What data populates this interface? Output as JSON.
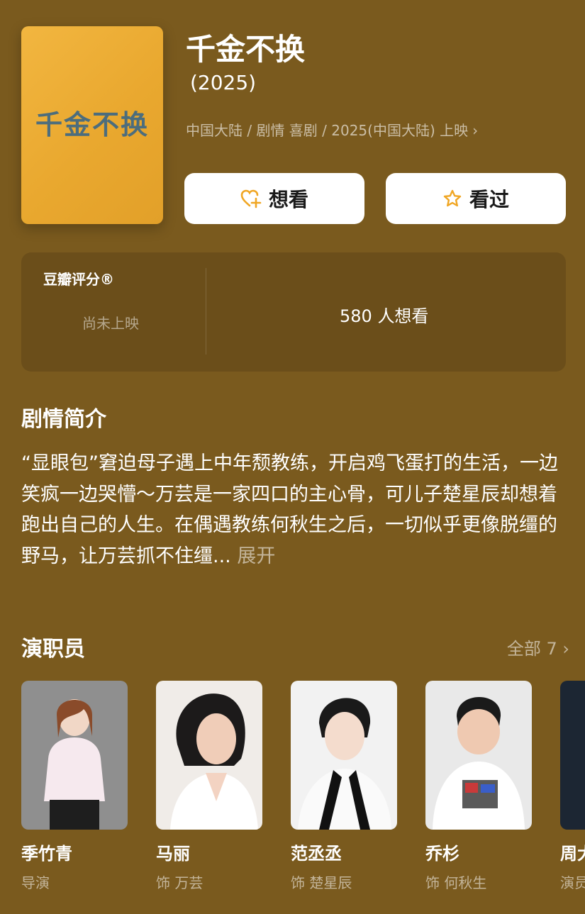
{
  "movie": {
    "poster_text": "千金不换",
    "title": "千金不换",
    "year": "(2025)",
    "meta": "中国大陆 / 剧情 喜剧 / 2025(中国大陆) 上映",
    "meta_chevron": "›"
  },
  "actions": {
    "want_label": "想看",
    "seen_label": "看过"
  },
  "rating": {
    "label": "豆瓣评分®",
    "status": "尚未上映",
    "wish_count": "580 人想看"
  },
  "synopsis": {
    "heading": "剧情简介",
    "text": "“显眼包”窘迫母子遇上中年颓教练，开启鸡飞蛋打的生活，一边笑疯一边哭懵～万芸是一家四口的主心骨，可儿子楚星辰却想着跑出自己的人生。在偶遇教练何秋生之后，一切似乎更像脱缰的野马，让万芸抓不住缰...",
    "expand": "展开"
  },
  "cast": {
    "heading": "演职员",
    "all_label": "全部 7",
    "all_chevron": "›",
    "members": [
      {
        "name": "季竹青",
        "role": "导演"
      },
      {
        "name": "马丽",
        "role": "饰 万芸"
      },
      {
        "name": "范丞丞",
        "role": "饰 楚星辰"
      },
      {
        "name": "乔杉",
        "role": "饰 何秋生"
      },
      {
        "name": "周大",
        "role": "演员"
      }
    ]
  },
  "colors": {
    "background": "#7a5a1e",
    "card": "#6b4e1a",
    "accent": "#f0a623"
  }
}
